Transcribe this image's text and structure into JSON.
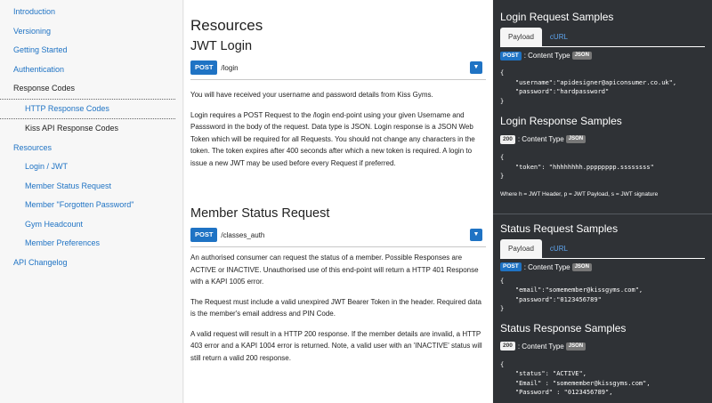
{
  "sidebar": {
    "items": [
      {
        "label": "Introduction"
      },
      {
        "label": "Versioning"
      },
      {
        "label": "Getting Started"
      },
      {
        "label": "Authentication"
      },
      {
        "label": "Response Codes"
      },
      {
        "label": "HTTP Response Codes"
      },
      {
        "label": "Kiss API Response Codes"
      },
      {
        "label": "Resources"
      },
      {
        "label": "Login / JWT"
      },
      {
        "label": "Member Status Request"
      },
      {
        "label": "Member \"Forgotten Password\""
      },
      {
        "label": "Gym Headcount"
      },
      {
        "label": "Member Preferences"
      },
      {
        "label": "API Changelog"
      }
    ]
  },
  "main": {
    "title": "Resources",
    "sections": [
      {
        "heading": "JWT Login",
        "method": "POST",
        "path": "/login",
        "expand_icon": "chevron-down-icon",
        "paragraphs": [
          "You will have received your username and password details from Kiss Gyms.",
          "Login requires a POST Request to the /login end-point using your given Username and Passsword in the body of the request. Data type is JSON. Login response is a JSON Web Token which will be required for all Requests. You should not change any characters in the token. The token expires after 400 seconds after which a new token is required. A login to issue a new JWT may be used before every Request if preferred."
        ]
      },
      {
        "heading": "Member Status Request",
        "method": "POST",
        "path": "/classes_auth",
        "expand_icon": "chevron-down-icon",
        "paragraphs": [
          "An authorised consumer can request the status of a member. Possible Responses are ACTIVE or INACTIVE. Unauthorised use of this end-point will return a HTTP 401 Response with a KAPI 1005 error.",
          "The Request must include a valid unexpired JWT Bearer Token in the header. Required data is the member's email address and PIN Code.",
          "A valid request will result in a HTTP 200 response. If the member details are invalid, a HTTP 403 error and a KAPI 1004 error is returned. Note, a valid user with an 'INACTIVE' status will still return a valid 200 response."
        ]
      }
    ]
  },
  "samples": {
    "login_request": {
      "title": "Login Request Samples",
      "tabs": [
        "Payload",
        "cURL"
      ],
      "badge": "POST",
      "content_type_label": ": Content Type",
      "format": "JSON",
      "code": "{\n    \"username\":\"apidesigner@apiconsumer.co.uk\",\n    \"password\":\"hardpassword\"\n}"
    },
    "login_response": {
      "title": "Login Response Samples",
      "badge": "200",
      "content_type_label": ": Content Type",
      "format": "JSON",
      "code": "{\n    \"token\": \"hhhhhhhh.pppppppp.ssssssss\"\n}",
      "note": "Where h = JWT Header, p = JWT Payload, s = JWT signature"
    },
    "status_request": {
      "title": "Status Request Samples",
      "tabs": [
        "Payload",
        "cURL"
      ],
      "badge": "POST",
      "content_type_label": ": Content Type",
      "format": "JSON",
      "code": "{\n    \"email\":\"somemember@kissgyms.com\",\n    \"password\":\"0123456789\"\n}"
    },
    "status_response": {
      "title": "Status Response Samples",
      "badge": "200",
      "content_type_label": ": Content Type",
      "format": "JSON",
      "code": "{\n    \"status\": \"ACTIVE\",\n    \"Email\" : \"somemember@kissgyms.com\",\n    \"Password\" : \"0123456789\","
    }
  },
  "colors": {
    "link": "#1f73c4",
    "dark_panel": "#2f3236",
    "sidebar_bg": "#f7f7f7"
  }
}
